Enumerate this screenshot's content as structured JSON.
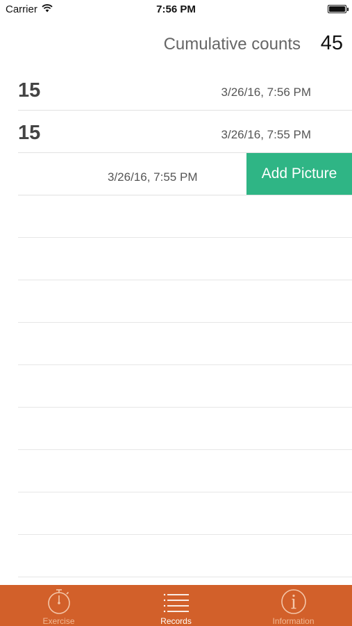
{
  "status_bar": {
    "carrier": "Carrier",
    "time": "7:56 PM"
  },
  "header": {
    "label": "Cumulative counts",
    "value": "45"
  },
  "records": [
    {
      "count": "15",
      "date": "3/26/16, 7:56 PM"
    },
    {
      "count": "15",
      "date": "3/26/16, 7:55 PM"
    },
    {
      "count": "",
      "date": "3/26/16, 7:55 PM",
      "action_label": "Add Picture"
    }
  ],
  "tab_bar": {
    "tabs": [
      {
        "label": "Exercise",
        "icon": "stopwatch-icon"
      },
      {
        "label": "Records",
        "icon": "list-icon",
        "active": true
      },
      {
        "label": "Information",
        "icon": "info-icon"
      }
    ]
  },
  "colors": {
    "tab_bar": "#d2602a",
    "add_picture": "#2fb585"
  }
}
